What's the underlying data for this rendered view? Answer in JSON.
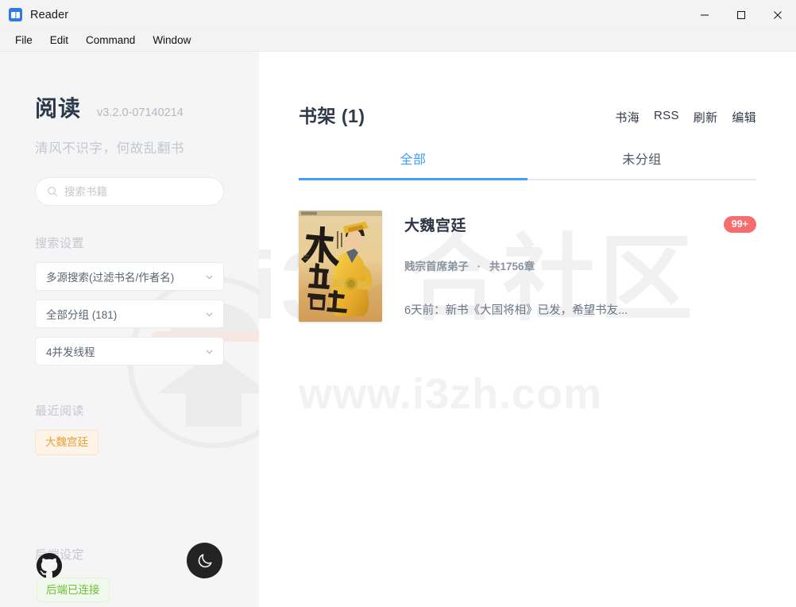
{
  "window": {
    "title": "Reader",
    "app_icon": "book-icon",
    "controls": {
      "minimize": "minimize-icon",
      "maximize": "maximize-icon",
      "close": "close-icon"
    }
  },
  "menubar": {
    "items": [
      {
        "label": "File"
      },
      {
        "label": "Edit"
      },
      {
        "label": "Command"
      },
      {
        "label": "Window"
      }
    ]
  },
  "sidebar": {
    "brand": "阅读",
    "version": "v3.2.0-07140214",
    "tagline": "清风不识字，何故乱翻书",
    "search": {
      "placeholder": "搜索书籍",
      "value": "",
      "icon": "search-icon"
    },
    "search_settings_label": "搜索设置",
    "selects": [
      {
        "name": "search-mode",
        "value": "多源搜索(过滤书名/作者名)"
      },
      {
        "name": "group-filter",
        "value": "全部分组 (181)"
      },
      {
        "name": "thread-count",
        "value": "4并发线程"
      }
    ],
    "recent_label": "最近阅读",
    "recent_books": [
      {
        "label": "大魏宫廷"
      }
    ],
    "footer_label": "后端设定",
    "github_icon": "github-icon",
    "theme_toggle_icon": "moon-icon",
    "status": "后端已连接"
  },
  "main": {
    "title": "书架 (1)",
    "actions": [
      {
        "label": "书海"
      },
      {
        "label": "RSS"
      },
      {
        "label": "刷新"
      },
      {
        "label": "编辑"
      }
    ],
    "tabs": [
      {
        "label": "全部",
        "active": true
      },
      {
        "label": "未分组",
        "active": false
      }
    ],
    "books": [
      {
        "title": "大魏宫廷",
        "author": "贱宗首席弟子",
        "separator": "·",
        "chapters": "共1756章",
        "latest": "6天前：新书《大国将相》已发，希望书友...",
        "badge": "99+",
        "cover_alt": "大魏宫廷"
      }
    ]
  },
  "watermark": {
    "logo": "i3-logo-watermark",
    "text_left": "i3",
    "text_right": "合社区",
    "url": "www.i3zh.com"
  },
  "colors": {
    "accent": "#409eff",
    "badge": "#f76c6c",
    "success": "#67c23a",
    "warning": "#e6a23c",
    "sidebar_bg": "#f5f5f6",
    "title_text": "#303a4a"
  }
}
